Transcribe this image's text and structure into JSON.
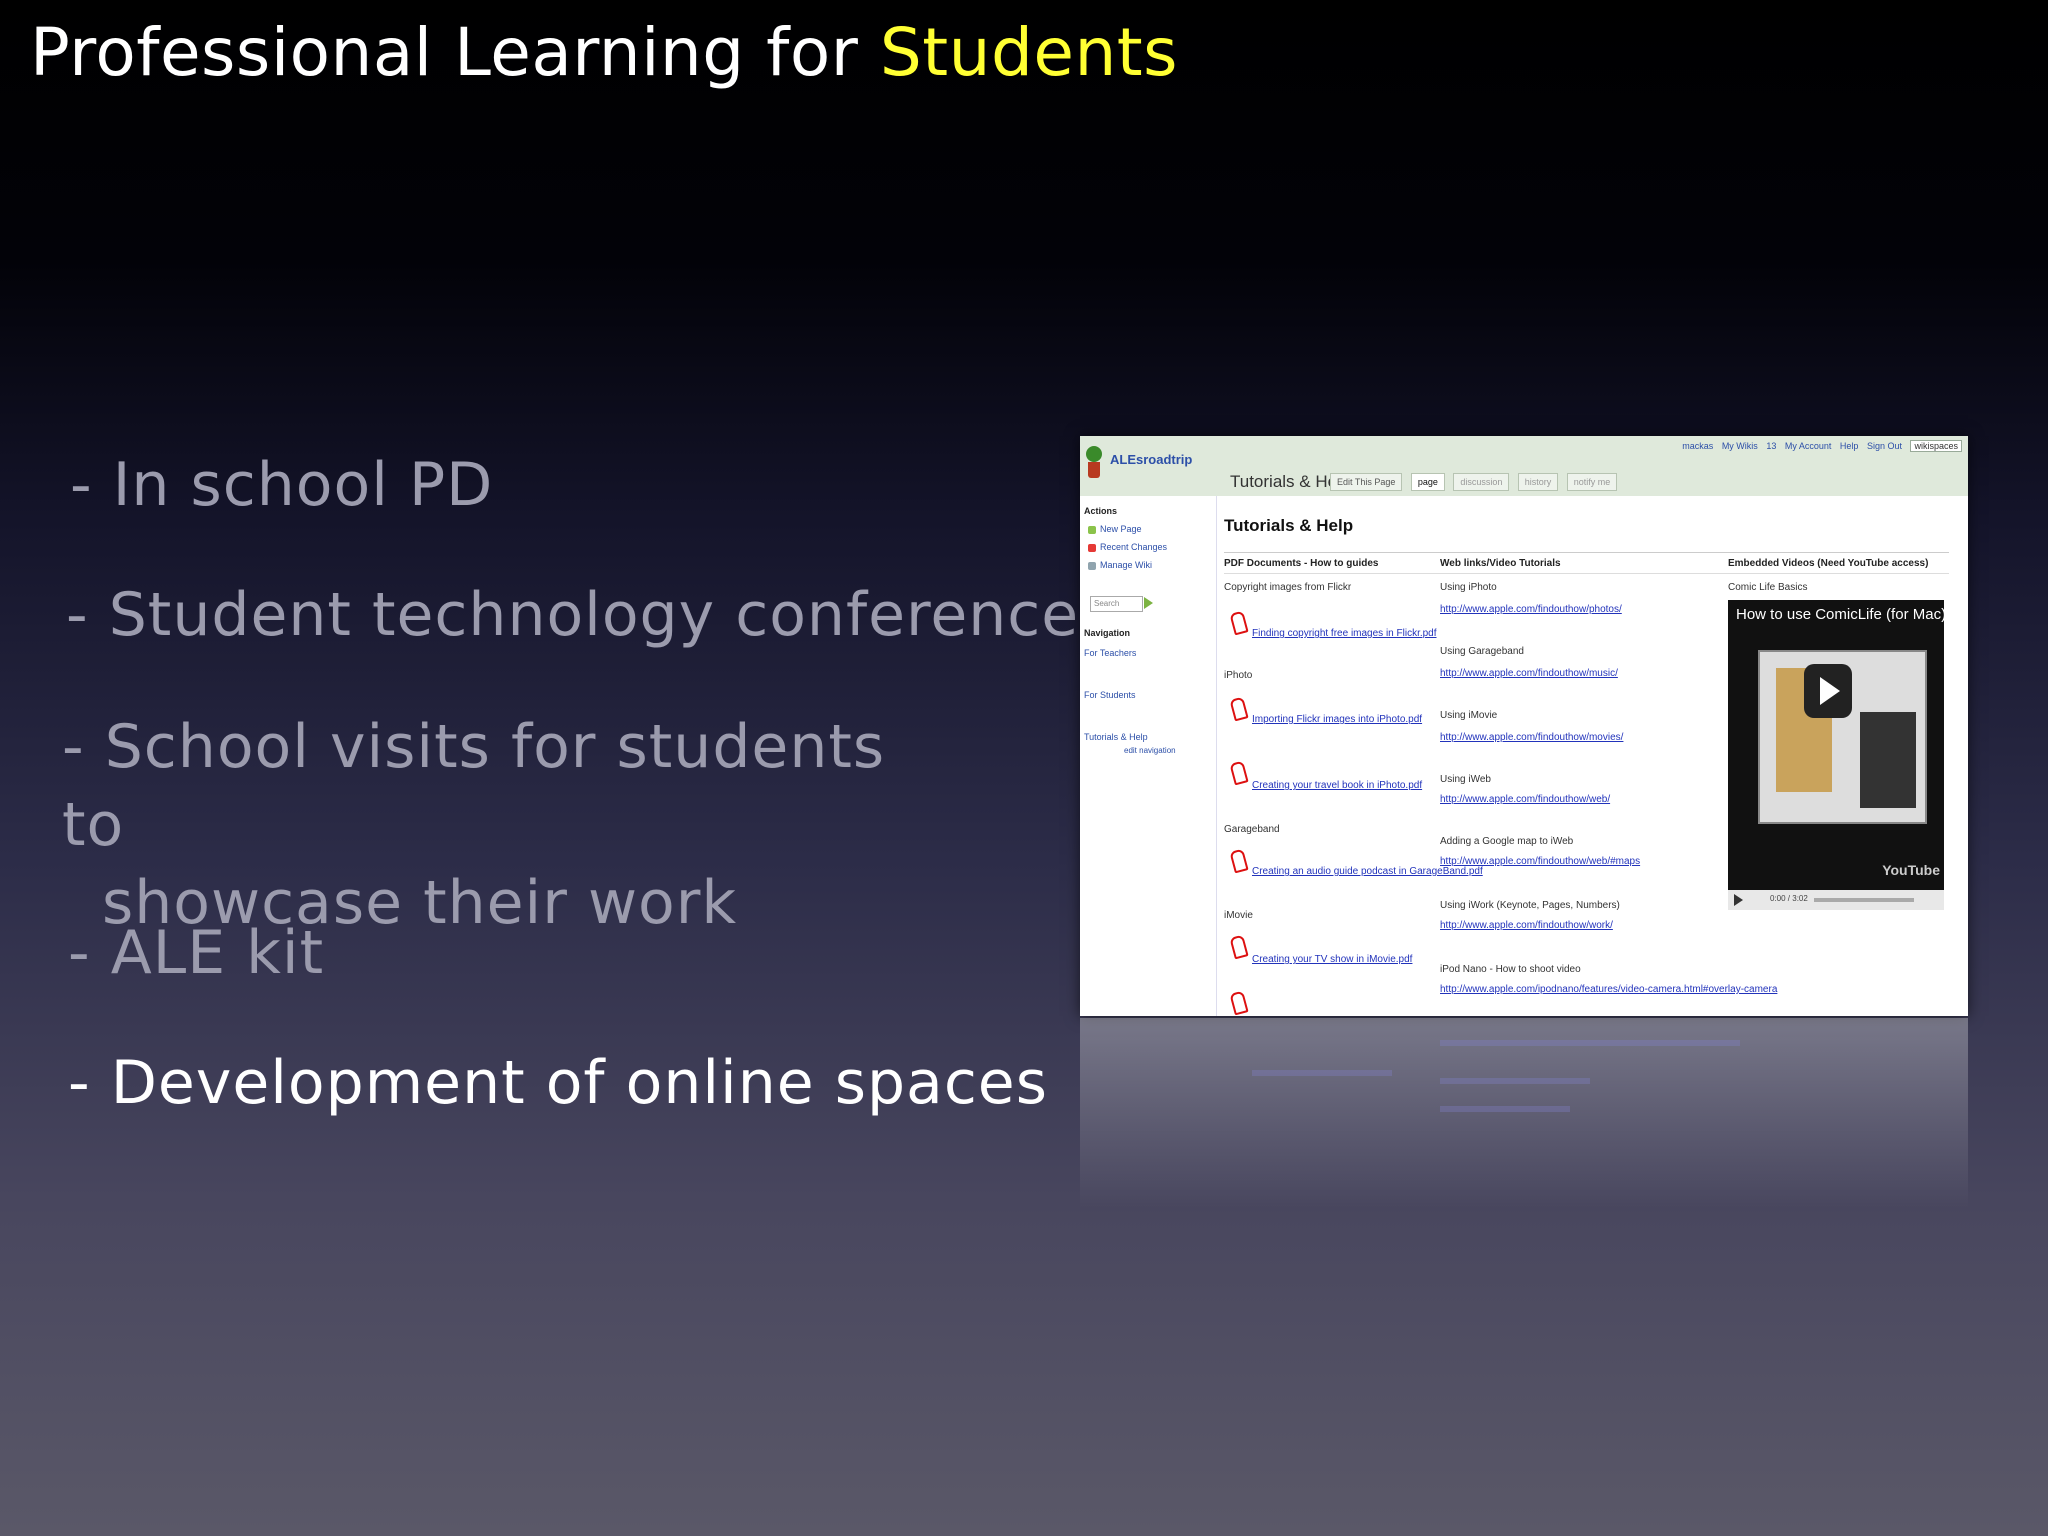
{
  "slide": {
    "title_part1": "Professional Learning for ",
    "title_highlight": "Students",
    "bullets": [
      "- In school PD",
      "- Student technology conferences",
      "- School visits for students to",
      "showcase their work",
      "- ALE kit",
      "- Development of online spaces"
    ]
  },
  "screenshot": {
    "site_name": "ALEsroadtrip",
    "user_links": [
      "mackas",
      "My Wikis",
      "13",
      "My Account",
      "Help",
      "Sign Out"
    ],
    "wikispaces_badge": "wikispaces",
    "page_title": "Tutorials & Help",
    "tabs": [
      "Edit This Page",
      "page",
      "discussion",
      "history",
      "notify me"
    ],
    "heading": "Tutorials & Help",
    "sidebar": {
      "actions_heading": "Actions",
      "actions": [
        "New Page",
        "Recent Changes",
        "Manage Wiki"
      ],
      "search_placeholder": "Search",
      "navigation_heading": "Navigation",
      "nav_items": [
        "For Teachers",
        "For Students",
        "Tutorials & Help",
        "edit navigation"
      ]
    },
    "columns": {
      "col1": "PDF Documents - How to guides",
      "col2": "Web links/Video Tutorials",
      "col3": "Embedded Videos (Need YouTube access)"
    },
    "pdf_section": {
      "group1": "Copyright images from Flickr",
      "link1": "Finding copyright free images in Flickr.pdf",
      "group2": "iPhoto",
      "link2": "Importing Flickr images into iPhoto.pdf",
      "link3": "Creating your travel book in iPhoto.pdf",
      "group3": "Garageband",
      "link4": "Creating an audio guide podcast in GarageBand.pdf",
      "group4": "iMovie",
      "link5": "Creating your TV show in iMovie.pdf"
    },
    "web_links": [
      {
        "label": "Using iPhoto",
        "url": "http://www.apple.com/findouthow/photos/"
      },
      {
        "label": "Using Garageband",
        "url": "http://www.apple.com/findouthow/music/"
      },
      {
        "label": "Using iMovie",
        "url": "http://www.apple.com/findouthow/movies/"
      },
      {
        "label": "Using iWeb",
        "url": "http://www.apple.com/findouthow/web/"
      },
      {
        "label": "Adding a Google map to iWeb",
        "url": "http://www.apple.com/findouthow/web/#maps"
      },
      {
        "label": "Using iWork (Keynote, Pages, Numbers)",
        "url": "http://www.apple.com/findouthow/work/"
      },
      {
        "label": "iPod Nano - How to shoot video",
        "url": "http://www.apple.com/ipodnano/features/video-camera.html#overlay-camera"
      }
    ],
    "video": {
      "caption": "Comic Life Basics",
      "title": "How to use ComicLife (for Mac)",
      "time": "0:00 / 3:02",
      "brand": "YouTube"
    }
  }
}
